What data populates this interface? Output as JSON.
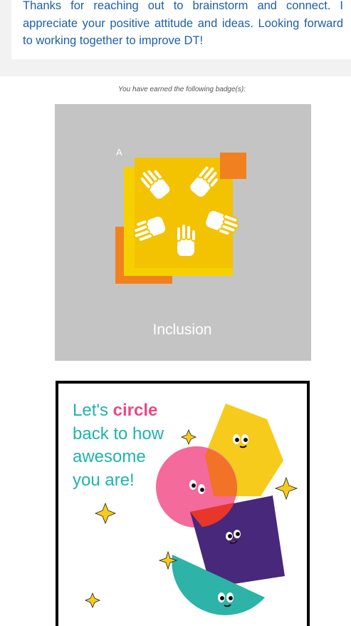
{
  "message": {
    "text": "Thanks for reaching out to brainstorm and connect.  I appreciate your positive attitude and ideas.  Looking forward to working together to improve DT!"
  },
  "badge": {
    "caption": "You have earned the following badge(s):",
    "alt_marker": "A",
    "name": "Inclusion",
    "art": "hands-circle-icon",
    "colors": {
      "background": "#c4c4c4",
      "yellow": "#f6d100",
      "orange": "#f1811f",
      "gold": "#f3c200"
    }
  },
  "ecard": {
    "line1_prefix": "Let's ",
    "line1_emphasis": "circle",
    "line2": "back to how",
    "line3": "awesome",
    "line4": "you are!",
    "colors": {
      "teal": "#1fb3ae",
      "pink": "#e94a87",
      "yellow": "#f6cb1c",
      "purple": "#4b2a7a",
      "aqua": "#2db3a8"
    }
  }
}
